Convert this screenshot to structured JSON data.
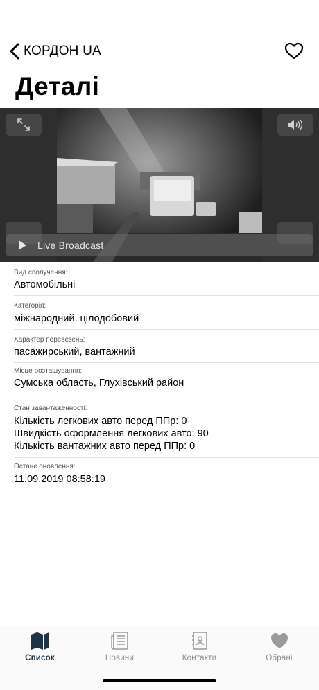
{
  "header": {
    "back_label": "КОРДОН UA",
    "title": "Деталі"
  },
  "video": {
    "live_label": "Live Broadcast"
  },
  "details": [
    {
      "label": "Вид сполучення:",
      "values": [
        "Автомобільні"
      ]
    },
    {
      "label": "Категорія:",
      "values": [
        "міжнародний, цілодобовий"
      ]
    },
    {
      "label": "Характер перевезень:",
      "values": [
        "пасажирський, вантажний"
      ]
    },
    {
      "label": "Місце розташування:",
      "values": [
        "Сумська область, Глухівський район"
      ]
    },
    {
      "label": "Стан завантаженності:",
      "values": [
        "Кількість легкових авто перед ППр: 0",
        "Швидкість оформлення легкових авто: 90",
        "Кількість вантажних авто перед ППр: 0"
      ]
    },
    {
      "label": "Останє оновлення:",
      "values": [
        "11.09.2019 08:58:19"
      ]
    }
  ],
  "tabs": [
    {
      "label": "Список",
      "icon": "map-icon",
      "active": true
    },
    {
      "label": "Новини",
      "icon": "newspaper-icon",
      "active": false
    },
    {
      "label": "Контакти",
      "icon": "contact-book-icon",
      "active": false
    },
    {
      "label": "Обрані",
      "icon": "heart-icon",
      "active": false
    }
  ],
  "colors": {
    "active_tab": "#1f3348",
    "inactive_tab": "#8e8e8e"
  }
}
